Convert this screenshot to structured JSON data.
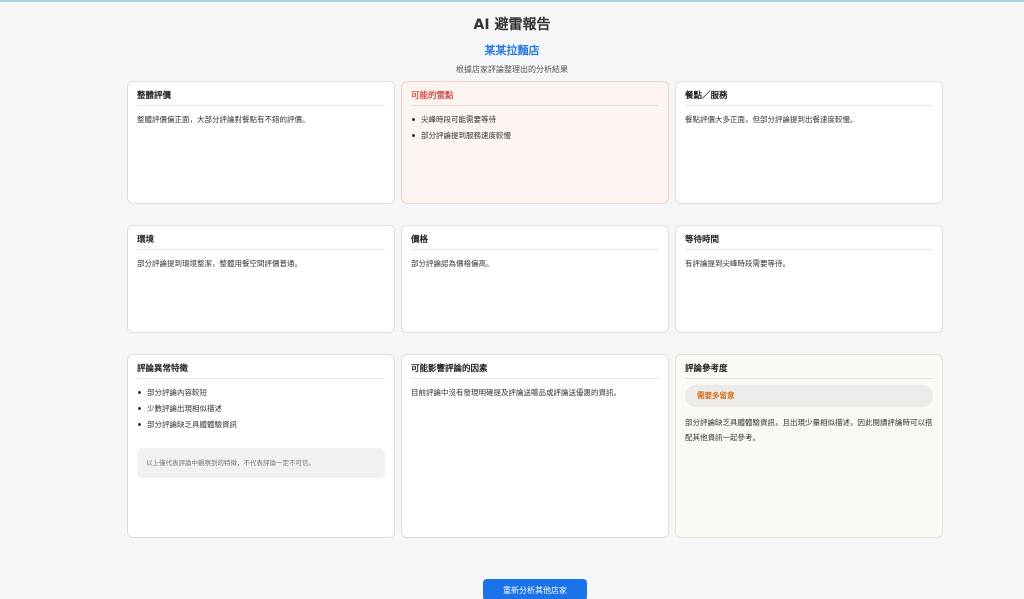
{
  "header": {
    "title": "AI 避雷報告",
    "shop_name": "某某拉麵店",
    "subtitle": "根據店家評論整理出的分析結果"
  },
  "cards": {
    "overall": {
      "title": "整體評價",
      "text": "整體評價偏正面，大部分評論對餐點有不錯的評價。"
    },
    "pitfalls": {
      "title": "可能的雷點",
      "items": [
        "尖峰時段可能需要等待",
        "部分評論提到服務速度較慢"
      ]
    },
    "food": {
      "title": "餐點／服務",
      "text": "餐點評價大多正面，但部分評論提到出餐速度較慢。"
    },
    "environment": {
      "title": "環境",
      "text": "部分評論提到環境整潔，整體用餐空間評價普通。"
    },
    "price": {
      "title": "價格",
      "text": "部分評論認為價格偏高。"
    },
    "wait": {
      "title": "等待時間",
      "text": "有評論提到尖峰時段需要等待。"
    },
    "anomaly": {
      "title": "評論異常特徵",
      "items": [
        "部分評論內容較短",
        "少數評論出現相似描述",
        "部分評論缺乏具體體驗資訊"
      ],
      "note": "以上僅代表評論中觀察到的特徵，不代表評論一定不可信。"
    },
    "factors": {
      "title": "可能影響評論的因素",
      "text": "目前評論中沒有發現明確提及評論送贈品或評論送優惠的資訊。"
    },
    "reference": {
      "title": "評論參考度",
      "badge": "需要多留意",
      "text": "部分評論缺乏具體體驗資訊，且出現少量相似描述，因此閱讀評論時可以搭配其他資訊一起參考。"
    }
  },
  "actions": {
    "reanalyze_label": "重新分析其他店家"
  },
  "colors": {
    "accent": "#1a73e8",
    "warning": "#d9534f",
    "badge_text": "#d4721f"
  }
}
